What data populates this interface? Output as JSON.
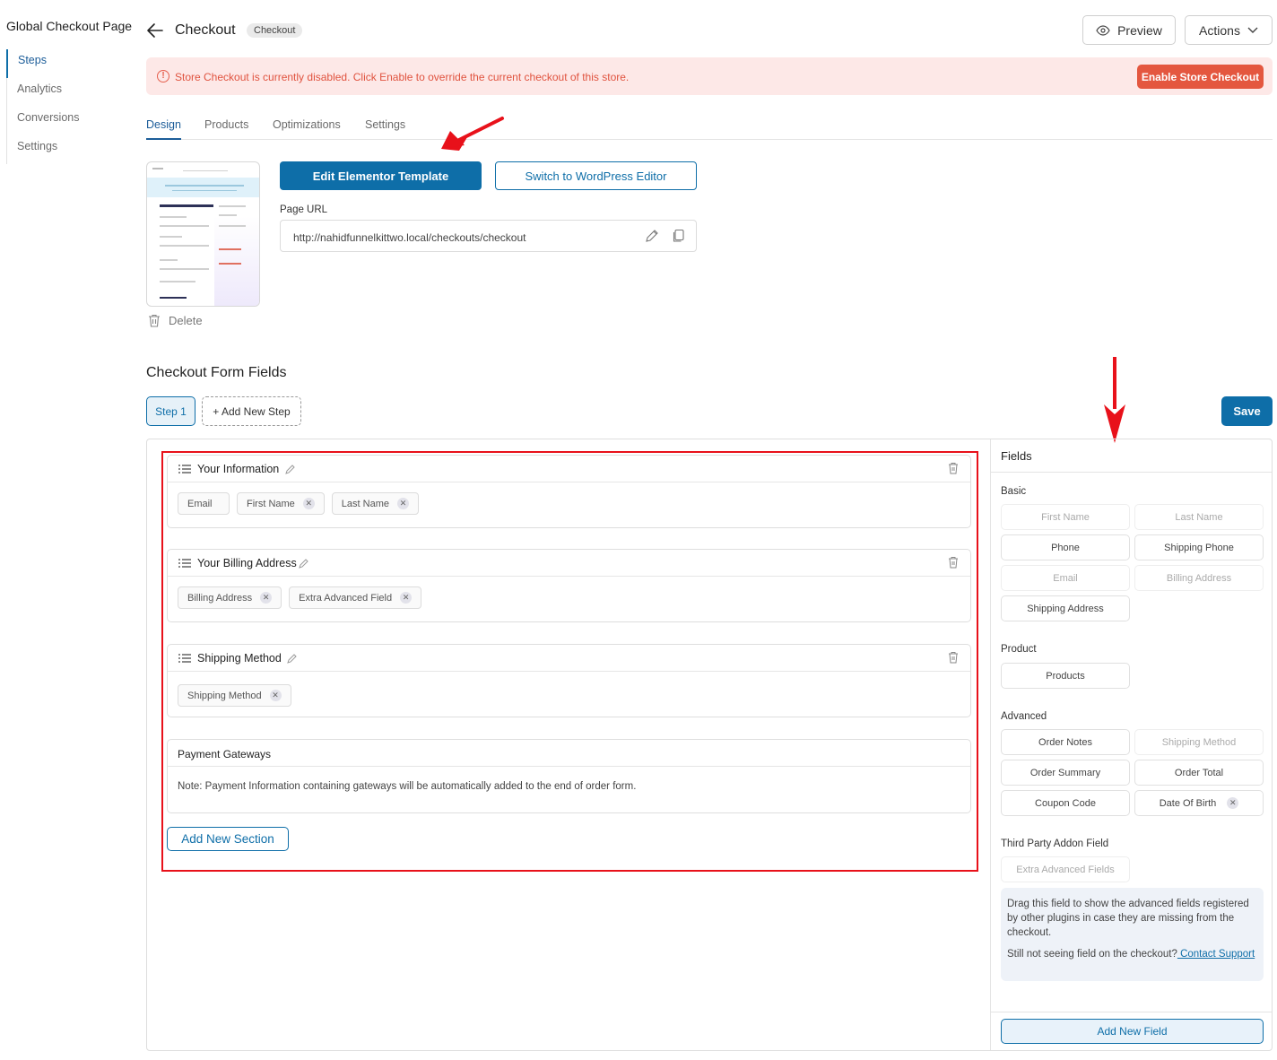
{
  "sidebar": {
    "title": "Global Checkout Page",
    "items": [
      {
        "label": "Steps",
        "active": true
      },
      {
        "label": "Analytics",
        "active": false
      },
      {
        "label": "Conversions",
        "active": false
      },
      {
        "label": "Settings",
        "active": false
      }
    ]
  },
  "header": {
    "title": "Checkout",
    "badge": "Checkout",
    "preview_label": "Preview",
    "actions_label": "Actions"
  },
  "alert": {
    "message": "Store Checkout is currently disabled. Click Enable to override the current checkout of this store.",
    "button_label": "Enable Store Checkout"
  },
  "tabs": [
    "Design",
    "Products",
    "Optimizations",
    "Settings"
  ],
  "design": {
    "edit_button": "Edit Elementor Template",
    "switch_button": "Switch to WordPress Editor",
    "url_label": "Page URL",
    "url_value": "http://nahidfunnelkittwo.local/checkouts/checkout",
    "delete_label": "Delete"
  },
  "form": {
    "title": "Checkout Form Fields",
    "step_label": "Step 1",
    "add_step_label": "+ Add New Step",
    "save_label": "Save",
    "sections": [
      {
        "title": "Your Information",
        "chips": [
          {
            "label": "Email",
            "removable": false
          },
          {
            "label": "First Name",
            "removable": true
          },
          {
            "label": "Last Name",
            "removable": true
          }
        ]
      },
      {
        "title": "Your Billing Address",
        "chips": [
          {
            "label": "Billing Address",
            "removable": true
          },
          {
            "label": "Extra Advanced Field",
            "removable": true
          }
        ]
      },
      {
        "title": "Shipping Method",
        "chips": [
          {
            "label": "Shipping Method",
            "removable": true
          }
        ]
      }
    ],
    "payment": {
      "title": "Payment Gateways",
      "note": "Note: Payment Information containing gateways will be automatically added to the end of order form."
    },
    "add_section_label": "Add New Section"
  },
  "fields_panel": {
    "title": "Fields",
    "basic_label": "Basic",
    "basic": [
      "First Name",
      "Last Name",
      "Phone",
      "Shipping Phone",
      "Email",
      "Billing Address",
      "Shipping Address"
    ],
    "product_label": "Product",
    "product": [
      "Products"
    ],
    "advanced_label": "Advanced",
    "advanced": [
      "Order Notes",
      "Shipping Method",
      "Order Summary",
      "Order Total",
      "Coupon Code",
      "Date Of Birth"
    ],
    "third_party_label": "Third Party Addon Field",
    "third_party": [
      "Extra Advanced Fields"
    ],
    "info_text": "Drag this field to show the advanced fields registered by other plugins in case they are missing from the checkout.",
    "info_question": "Still not seeing field on the checkout?",
    "info_link": " Contact Support",
    "add_field_label": "Add New Field"
  },
  "colors": {
    "accent": "#0e6ea8",
    "alert_bg": "#fde8e7",
    "alert_text": "#e0533f",
    "annotation_red": "#e8111a"
  }
}
